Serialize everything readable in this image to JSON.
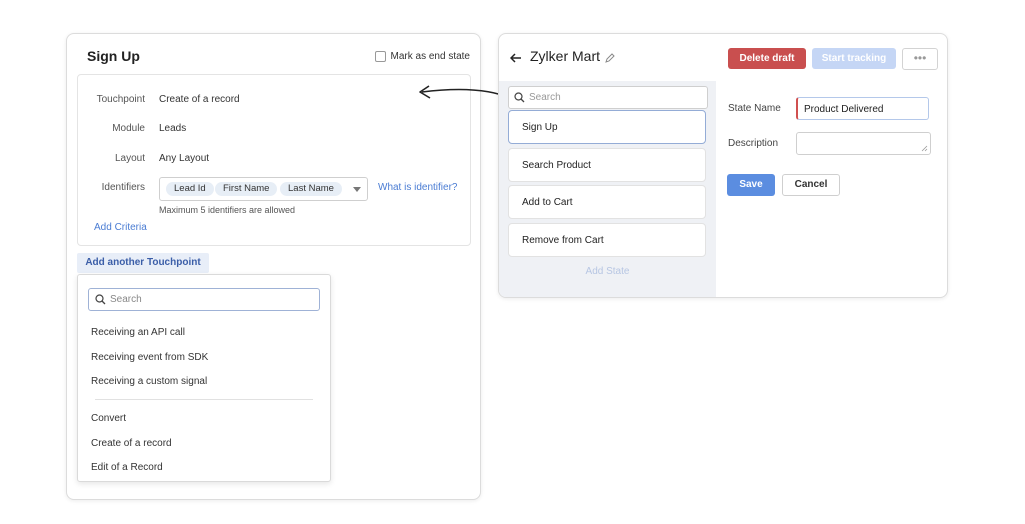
{
  "signup": {
    "title": "Sign Up",
    "end_state_label": "Mark as end state",
    "rows": {
      "touchpoint_label": "Touchpoint",
      "touchpoint_value": "Create of a record",
      "module_label": "Module",
      "module_value": "Leads",
      "layout_label": "Layout",
      "layout_value": "Any Layout",
      "identifiers_label": "Identifiers"
    },
    "identifiers": [
      "Lead Id",
      "First Name",
      "Last Name"
    ],
    "what_is_identifier": "What is identifier?",
    "identifier_hint": "Maximum 5 identifiers are allowed",
    "add_criteria": "Add Criteria",
    "add_touchpoint": "Add another Touchpoint",
    "dropdown": {
      "search_placeholder": "Search",
      "group1": [
        "Receiving an API call",
        "Receiving event from SDK",
        "Receiving a custom signal"
      ],
      "group2": [
        "Convert",
        "Create of a record",
        "Edit of a Record"
      ]
    }
  },
  "tracker": {
    "title": "Zylker Mart",
    "delete_draft": "Delete draft",
    "start_tracking": "Start tracking",
    "more": "•••",
    "search_placeholder": "Search",
    "states": [
      "Sign Up",
      "Search Product",
      "Add to Cart",
      "Remove from Cart"
    ],
    "add_state": "Add State",
    "state_name_label": "State Name",
    "state_name_value": "Product Delivered",
    "description_label": "Description",
    "save": "Save",
    "cancel": "Cancel"
  },
  "colors": {
    "danger": "#c94f4f",
    "primary": "#5b8de0",
    "disabled_primary": "#c5d6f5",
    "link": "#4a7cd3"
  }
}
